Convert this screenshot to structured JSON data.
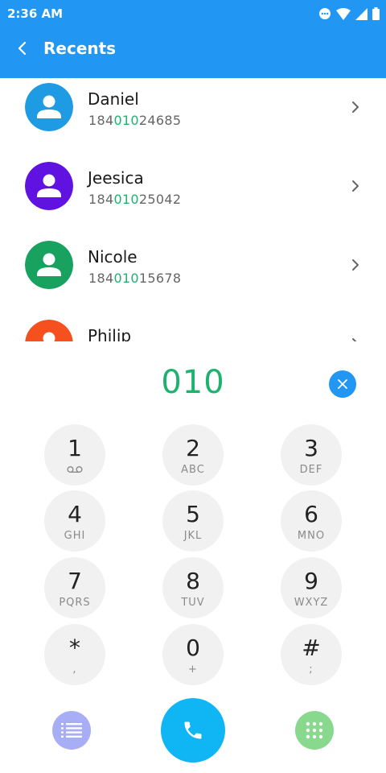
{
  "status_bar": {
    "time": "2:36 AM"
  },
  "header": {
    "title": "Recents"
  },
  "contacts": [
    {
      "name": "Daniel",
      "number_prefix": "184",
      "number_match": "010",
      "number_suffix": "24685",
      "avatar_color": "#1E9BE2"
    },
    {
      "name": "Jeesica",
      "number_prefix": "184",
      "number_match": "010",
      "number_suffix": "25042",
      "avatar_color": "#6012E0"
    },
    {
      "name": "Nicole",
      "number_prefix": "184",
      "number_match": "010",
      "number_suffix": "15678",
      "avatar_color": "#19A15F"
    },
    {
      "name": "Philip",
      "number_prefix": "",
      "number_match": "",
      "number_suffix": "",
      "avatar_color": "#F4511E"
    }
  ],
  "dialer": {
    "entered_number": "010",
    "keys": [
      {
        "digit": "1",
        "letters": ""
      },
      {
        "digit": "2",
        "letters": "ABC"
      },
      {
        "digit": "3",
        "letters": "DEF"
      },
      {
        "digit": "4",
        "letters": "GHI"
      },
      {
        "digit": "5",
        "letters": "JKL"
      },
      {
        "digit": "6",
        "letters": "MNO"
      },
      {
        "digit": "7",
        "letters": "PQRS"
      },
      {
        "digit": "8",
        "letters": "TUV"
      },
      {
        "digit": "9",
        "letters": "WXYZ"
      },
      {
        "digit": "*",
        "letters": ","
      },
      {
        "digit": "0",
        "letters": "+"
      },
      {
        "digit": "#",
        "letters": ";"
      }
    ]
  },
  "colors": {
    "primary": "#2196F3",
    "match_highlight": "#1DB36E",
    "call_button": "#10B5F4",
    "menu_button": "#A8AEF5",
    "keypad_button": "#88D98E"
  }
}
